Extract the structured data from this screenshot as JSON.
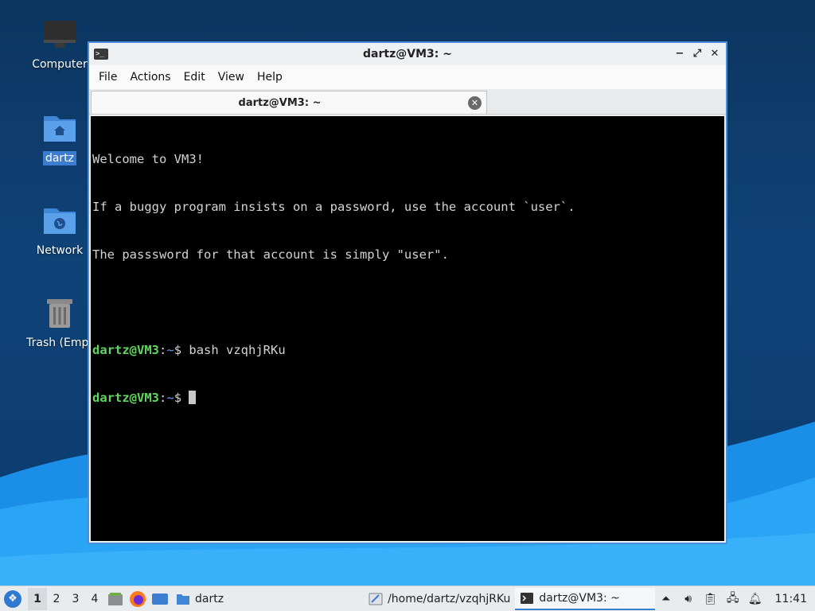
{
  "desktop": {
    "icons": [
      {
        "label": "Computer"
      },
      {
        "label": "dartz"
      },
      {
        "label": "Network"
      },
      {
        "label": "Trash (Empt"
      }
    ]
  },
  "window": {
    "title": "dartz@VM3: ~",
    "controls": {
      "minimize": "−",
      "maximize": "⤢",
      "close": "✕"
    },
    "menu": [
      "File",
      "Actions",
      "Edit",
      "View",
      "Help"
    ],
    "tab": {
      "label": "dartz@VM3: ~",
      "close": "✕"
    }
  },
  "terminal": {
    "lines": [
      "Welcome to VM3!",
      "If a buggy program insists on a password, use the account `user`.",
      "The passsword for that account is simply \"user\"."
    ],
    "prompt1": {
      "user": "dartz@VM3",
      "sep": ":",
      "path": "~",
      "dollar": "$ ",
      "command": "bash vzqhjRKu"
    },
    "prompt2": {
      "user": "dartz@VM3",
      "sep": ":",
      "path": "~",
      "dollar": "$ "
    }
  },
  "taskbar": {
    "workspaces": [
      "1",
      "2",
      "3",
      "4"
    ],
    "active_workspace": "1",
    "tasks": [
      {
        "label": "dartz",
        "icon": "folder-icon"
      },
      {
        "label": "/home/dartz/vzqhjRKu",
        "icon": "text-editor-icon"
      },
      {
        "label": "dartz@VM3: ~",
        "icon": "terminal-icon"
      }
    ],
    "clock": "11:41"
  },
  "colors": {
    "accent": "#3c7dd0",
    "prompt_user": "#5fd75f",
    "prompt_path": "#6c9cf0"
  }
}
